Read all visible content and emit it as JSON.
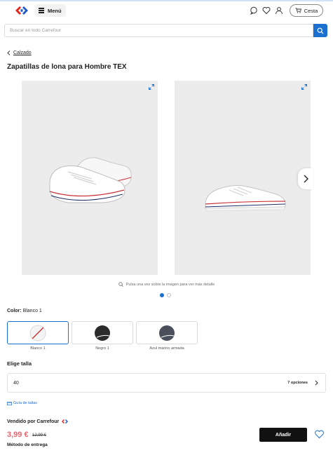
{
  "header": {
    "menu_label": "Menú",
    "cart_label": "Cesta"
  },
  "search": {
    "placeholder": "Buscar en todo Carrefour"
  },
  "breadcrumb": {
    "back_label": "Calzado"
  },
  "product": {
    "title": "Zapatillas de lona para Hombre TEX",
    "image_hint": "Pulsa una vez sobre la imagen para ver más detalle",
    "gallery_current": 1,
    "gallery_total": 2
  },
  "color": {
    "label": "Color:",
    "selected_value": "Blanco 1",
    "options": [
      {
        "name": "Blanco 1",
        "swatch": "#f4f4f4"
      },
      {
        "name": "Negro 1",
        "swatch": "#2b2b2b"
      },
      {
        "name": "Azul marino armada",
        "swatch": "#4a4f5c"
      }
    ]
  },
  "size": {
    "label": "Elige talla",
    "selected_value": "40",
    "options_count": "7 opciones",
    "guide_label": "Guía de tallas"
  },
  "seller": {
    "label": "Vendido por Carrefour"
  },
  "pricing": {
    "price": "3,99 €",
    "old_price": "12,99 €"
  },
  "actions": {
    "add_label": "Añadir"
  },
  "delivery": {
    "label": "Método de entrega"
  },
  "colors": {
    "accent": "#1a6fcf",
    "price": "#e9656f",
    "brand_red": "#e2231a",
    "brand_blue": "#1e5bc6"
  }
}
